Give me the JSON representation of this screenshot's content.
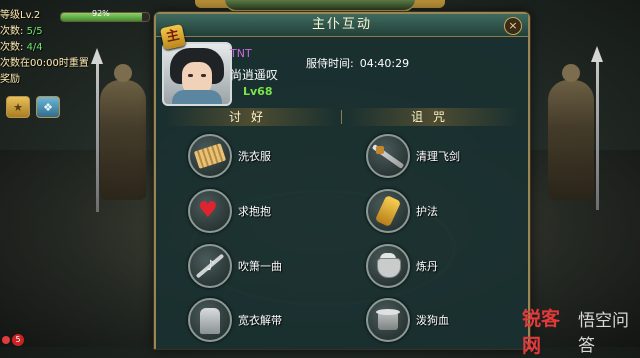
{
  "hud": {
    "rows": [
      {
        "label": "等级Lv.2",
        "value": ""
      },
      {
        "label": "次数:",
        "value": "5/5"
      },
      {
        "label": "次数:",
        "value": "4/4"
      },
      {
        "label": "次数在00:00时重置",
        "value": ""
      },
      {
        "label": "奖励",
        "value": ""
      }
    ],
    "level_progress_pct": "92%",
    "notification_count": "5"
  },
  "top_banner": "",
  "dialog": {
    "title": "主仆互动",
    "close_symbol": "×",
    "servant_tag": "主",
    "player_tag": "TNT",
    "character_name": "尚逍遥叹",
    "character_level": "Lv68",
    "service_time_label": "服侍时间:",
    "service_time_value": "04:40:29",
    "sections": {
      "left": "讨好",
      "right": "诅咒"
    },
    "left_actions": [
      {
        "label": "洗衣服",
        "icon": "washboard-icon"
      },
      {
        "label": "求抱抱",
        "icon": "heart-icon"
      },
      {
        "label": "吹箫一曲",
        "icon": "flute-icon"
      },
      {
        "label": "宽衣解带",
        "icon": "robe-icon"
      }
    ],
    "right_actions": [
      {
        "label": "清理飞剑",
        "icon": "sword-icon"
      },
      {
        "label": "护法",
        "icon": "staff-icon"
      },
      {
        "label": "炼丹",
        "icon": "cauldron-icon"
      },
      {
        "label": "泼狗血",
        "icon": "bucket-icon"
      }
    ]
  },
  "watermark": {
    "red_text": "锐客网",
    "grey_text": "悟空问答"
  }
}
